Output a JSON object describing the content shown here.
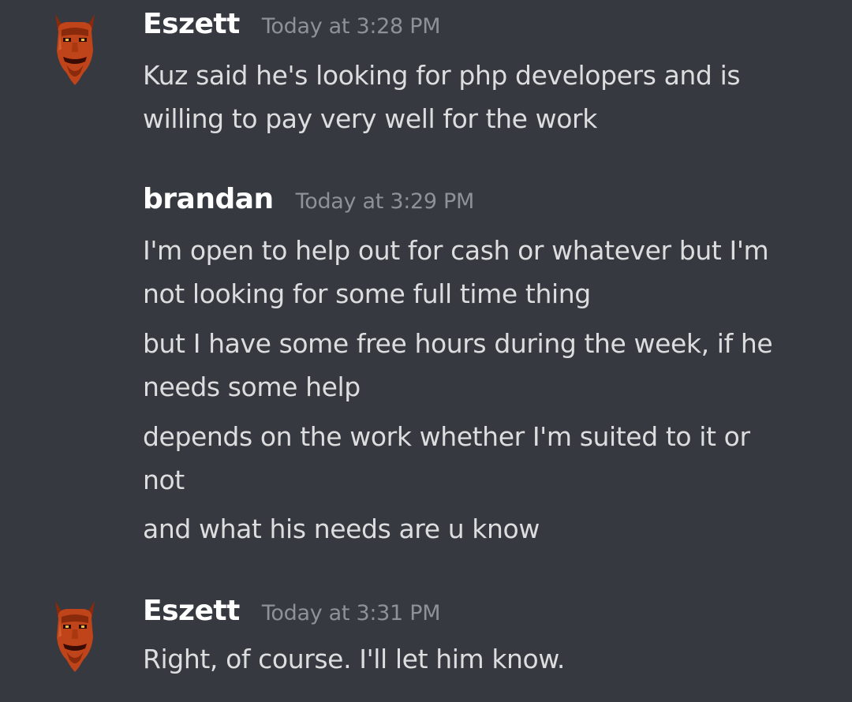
{
  "messages": [
    {
      "author": "Eszett",
      "timestamp": "Today at 3:28 PM",
      "avatar_icon": "devil-face-avatar-icon",
      "lines": [
        "Kuz said he's looking for php developers and is",
        "willing to pay very well for the work"
      ]
    },
    {
      "author": "brandan",
      "timestamp": "Today at 3:29 PM",
      "lines": [
        "I'm open to help out for cash or whatever but I'm",
        "not looking for some full time thing",
        "but I have some free hours during the week, if he",
        "needs some help",
        "depends on the work whether I'm suited to it or",
        "not",
        "and what his needs are u know"
      ]
    },
    {
      "author": "Eszett",
      "timestamp": "Today at 3:31 PM",
      "avatar_icon": "devil-face-avatar-icon",
      "lines": [
        "Right, of course. I'll let him know."
      ]
    }
  ],
  "colors": {
    "background": "#36393f",
    "username": "#ffffff",
    "timestamp": "#8e9297",
    "text": "#dcddde",
    "avatar_main": "#c0441a"
  }
}
